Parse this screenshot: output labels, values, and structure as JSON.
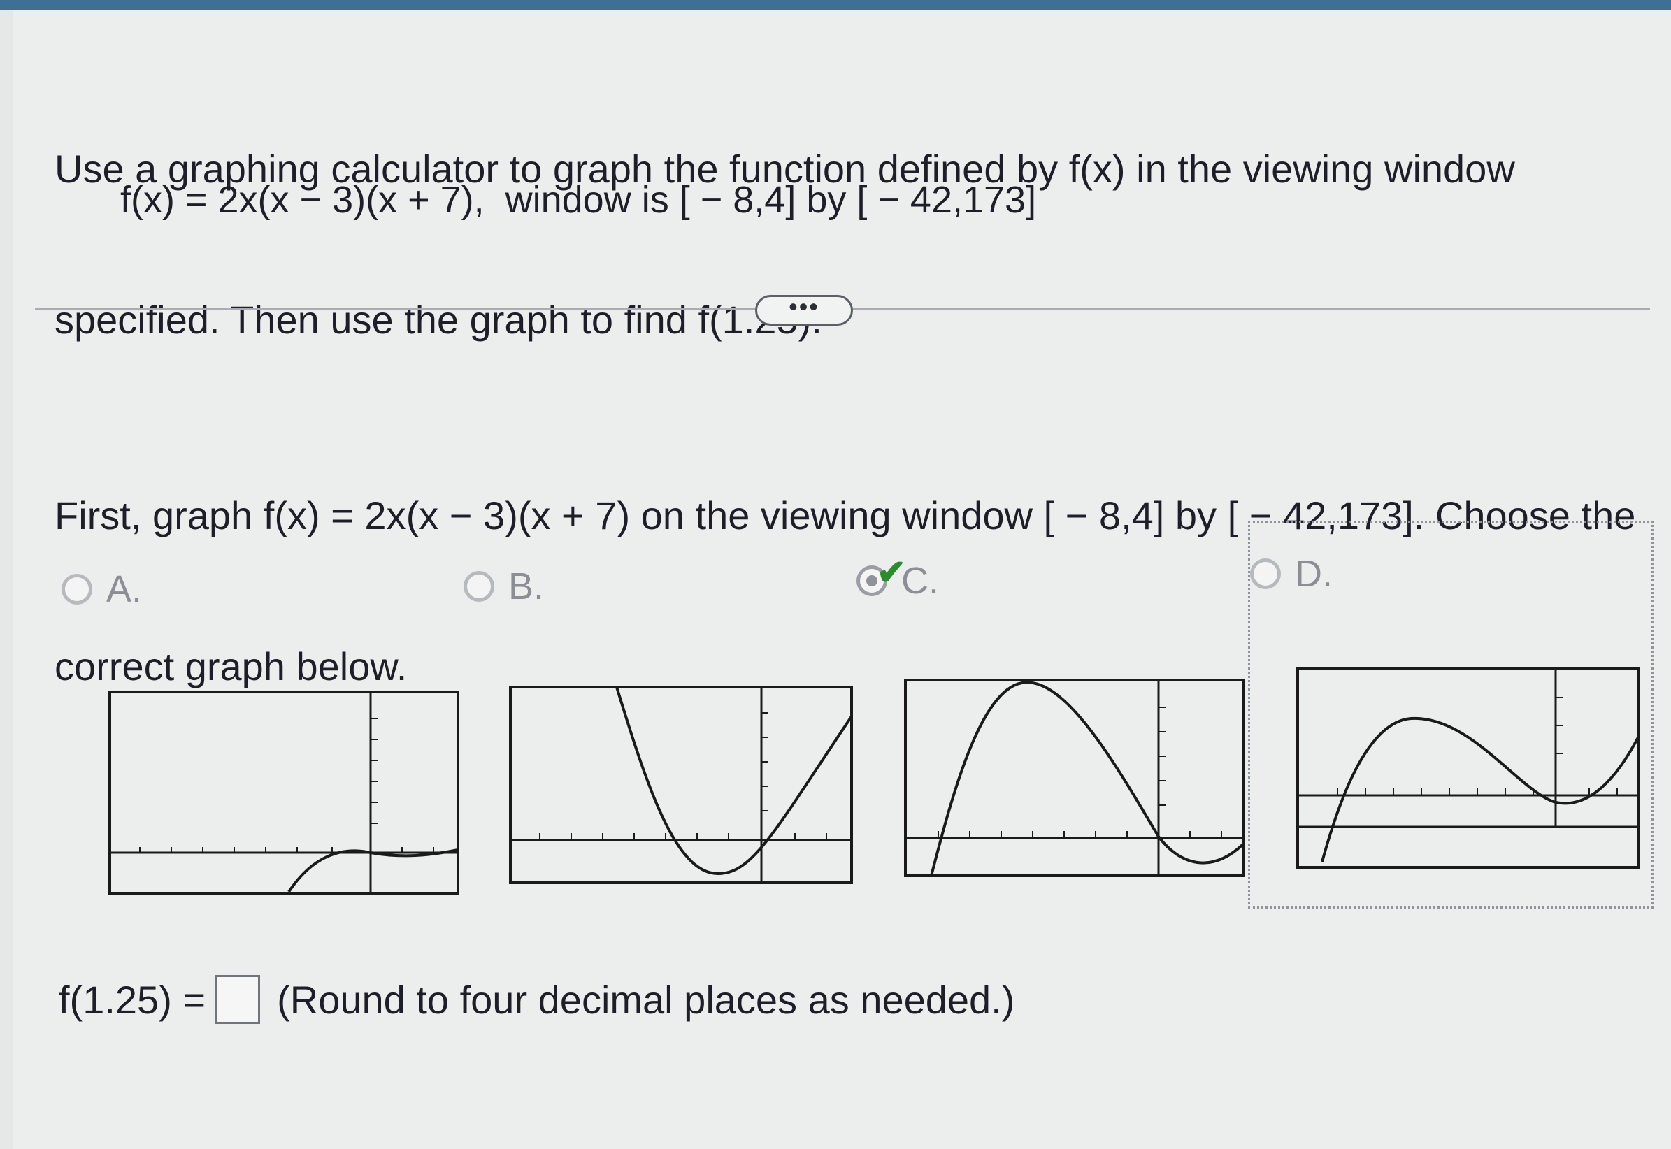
{
  "prompt_line1": "Use a graphing calculator to graph the function defined by f(x) in the viewing window",
  "prompt_line2": "specified. Then use the graph to find f(1.25).",
  "formula": "f(x) = 2x(x − 3)(x + 7),  window is [ − 8,4] by [ − 42,173]",
  "more_button": "•••",
  "question_line1": "First, graph f(x) = 2x(x − 3)(x + 7) on the viewing window [ − 8,4] by [ − 42,173]. Choose the",
  "question_line2": "correct graph below.",
  "options": [
    {
      "label": "A.",
      "selected": false
    },
    {
      "label": "B.",
      "selected": false
    },
    {
      "label": "C.",
      "selected": true,
      "correct": true
    },
    {
      "label": "D.",
      "selected": false
    }
  ],
  "check_icon": "checkmark-icon",
  "answer_prefix": "f(1.25) =",
  "answer_value": "",
  "answer_hint": "(Round to four decimal places as needed.)",
  "colors": {
    "accent": "#3f6f93",
    "correct": "#2e8a2e",
    "text": "#1e1e28"
  }
}
